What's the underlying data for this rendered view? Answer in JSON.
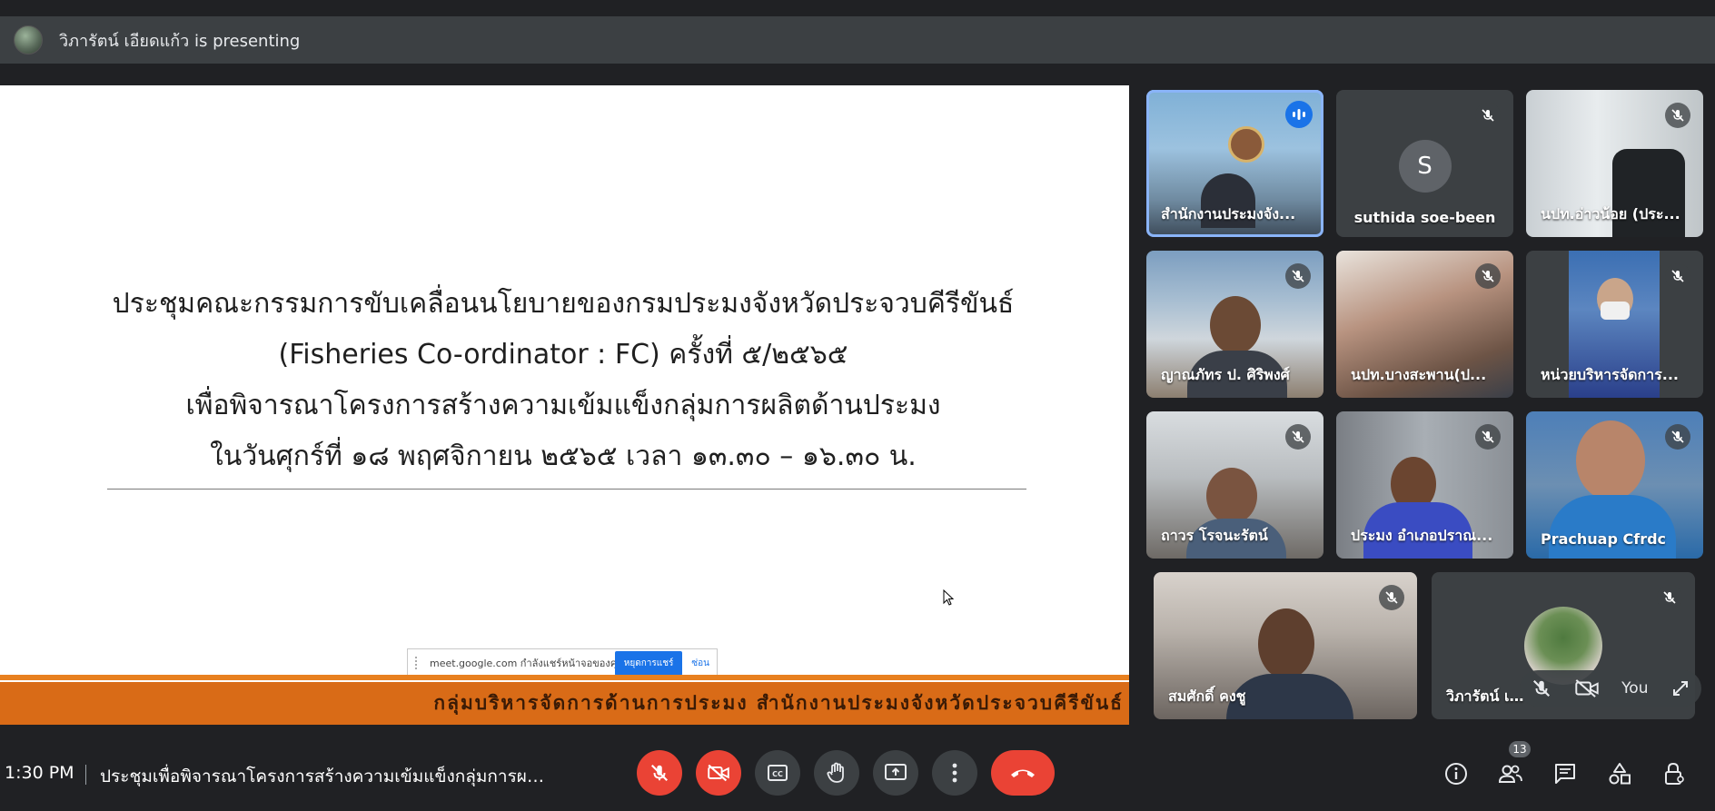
{
  "presenting_bar": {
    "text": "วิภารัตน์ เอียดแก้ว is presenting"
  },
  "slide": {
    "lines": [
      "ประชุมคณะกรรมการขับเคลื่อนนโยบายของกรมประมงจังหวัดประจวบคีรีขันธ์",
      "(Fisheries Co-ordinator  : FC) ครั้งที่ ๕/๒๕๖๕",
      "เพื่อพิจารณาโครงการสร้างความเข้มแข็งกลุ่มการผลิตด้านประมง",
      "ในวันศุกร์ที่ ๑๘ พฤศจิกายน ๒๕๖๕ เวลา ๑๓.๓๐ – ๑๖.๓๐ น."
    ],
    "banner": "กลุ่มบริหารจัดการด้านการประมง สำนักงานประมงจังหวัดประจวบคีรีขันธ์"
  },
  "share_notice": {
    "message": "meet.google.com กำลังแชร์หน้าจอของคุณ",
    "stop_label": "หยุดการแชร์",
    "hide_label": "ซ่อน"
  },
  "participants": [
    {
      "name": "สำนักงานประมงจัง...",
      "speaking": true
    },
    {
      "name": "suthida soe-been",
      "initial": "S"
    },
    {
      "name": "นปท.อ่าวน้อย (ประ..."
    },
    {
      "name": "ญาณภัทร ป. ศิริพงศ์"
    },
    {
      "name": "นปท.บางสะพาน(ป..."
    },
    {
      "name": "หน่วยบริหารจัดการ..."
    },
    {
      "name": "ถาวร โรจนะรัตน์"
    },
    {
      "name": "ประมง อำเภอปราณ..."
    },
    {
      "name": "Prachuap Cfrdc"
    },
    {
      "name": "สมศักดิ์ คงชู"
    },
    {
      "name": "วิภารัตน์ เอียดแก้ว"
    }
  ],
  "self_view": {
    "label": "You"
  },
  "bottom_bar": {
    "time": "1:30 PM",
    "meeting_title": "ประชุมเพื่อพิจารณาโครงการสร้างความเข้มแข็งกลุ่มการผลิ...",
    "participant_count": "13"
  },
  "colors": {
    "background": "#202124",
    "tile": "#3c4043",
    "red": "#ea4335",
    "speaking_outline": "#8ab4f8",
    "banner": "#d96b17"
  }
}
